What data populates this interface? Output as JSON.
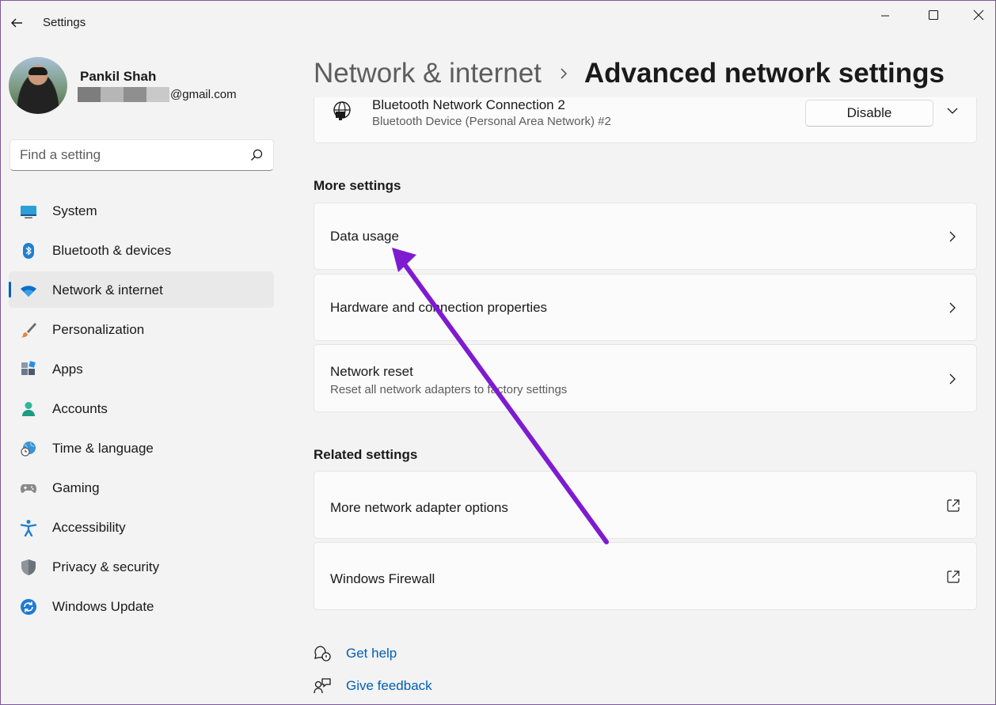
{
  "window": {
    "title": "Settings",
    "controls": [
      "minimize",
      "maximize",
      "close"
    ]
  },
  "user": {
    "name": "Pankil Shah",
    "email_suffix": "@gmail.com",
    "redaction_colors": [
      "#7d7d7d",
      "#b6b6b6",
      "#8f8f8f",
      "#c9c9c9"
    ]
  },
  "search": {
    "placeholder": "Find a setting",
    "value": ""
  },
  "sidebar": {
    "items": [
      {
        "label": "System",
        "icon": "system-icon",
        "active": false
      },
      {
        "label": "Bluetooth & devices",
        "icon": "bluetooth-icon",
        "active": false
      },
      {
        "label": "Network & internet",
        "icon": "wifi-icon",
        "active": true
      },
      {
        "label": "Personalization",
        "icon": "brush-icon",
        "active": false
      },
      {
        "label": "Apps",
        "icon": "apps-icon",
        "active": false
      },
      {
        "label": "Accounts",
        "icon": "person-icon",
        "active": false
      },
      {
        "label": "Time & language",
        "icon": "globe-clock-icon",
        "active": false
      },
      {
        "label": "Gaming",
        "icon": "gamepad-icon",
        "active": false
      },
      {
        "label": "Accessibility",
        "icon": "accessibility-icon",
        "active": false
      },
      {
        "label": "Privacy & security",
        "icon": "shield-icon",
        "active": false
      },
      {
        "label": "Windows Update",
        "icon": "update-icon",
        "active": false
      }
    ]
  },
  "breadcrumb": {
    "parent": "Network & internet",
    "current": "Advanced network settings"
  },
  "adapter": {
    "name": "Bluetooth Network Connection 2",
    "description": "Bluetooth Device (Personal Area Network) #2",
    "action": "Disable"
  },
  "more_settings": {
    "title": "More settings",
    "items": [
      {
        "label": "Data usage",
        "sub": ""
      },
      {
        "label": "Hardware and connection properties",
        "sub": ""
      },
      {
        "label": "Network reset",
        "sub": "Reset all network adapters to factory settings"
      }
    ]
  },
  "related_settings": {
    "title": "Related settings",
    "items": [
      {
        "label": "More network adapter options"
      },
      {
        "label": "Windows Firewall"
      }
    ]
  },
  "footer": {
    "help": "Get help",
    "feedback": "Give feedback"
  },
  "colors": {
    "accent": "#005fb8",
    "annotation_arrow": "#7e1bd1"
  }
}
